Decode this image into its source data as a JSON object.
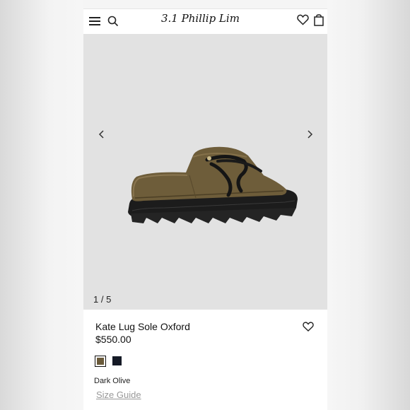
{
  "header": {
    "brand": "3.1 Phillip Lim",
    "icons": [
      "menu-icon",
      "search-icon",
      "heart-icon",
      "bag-icon"
    ]
  },
  "gallery": {
    "counter": "1 / 5",
    "icons": [
      "chevron-left-icon",
      "chevron-right-icon"
    ]
  },
  "product": {
    "name": "Kate Lug Sole Oxford",
    "price": "$550.00",
    "selected_color": "Dark Olive",
    "size_guide": "Size Guide"
  },
  "swatches": [
    {
      "color": "#6a5a3a",
      "selected": true
    },
    {
      "color": "#151a26",
      "selected": false
    }
  ],
  "colors": {
    "accent": "#111111",
    "gallery_bg": "#e2e2e2",
    "muted_link": "#999999"
  }
}
